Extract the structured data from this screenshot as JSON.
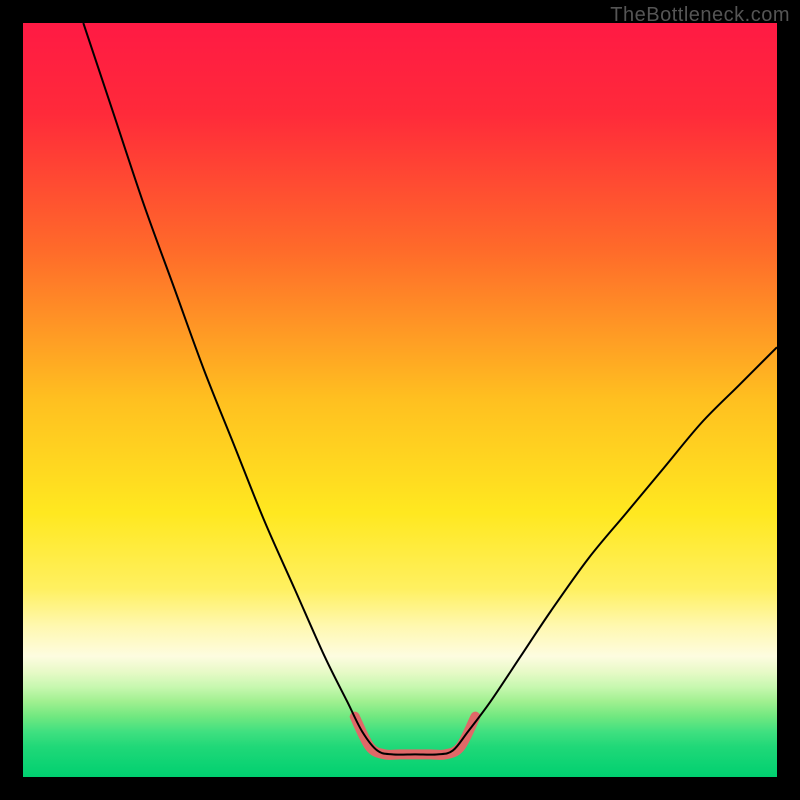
{
  "watermark": "TheBottleneck.com",
  "chart_data": {
    "type": "line",
    "title": "",
    "xlabel": "",
    "ylabel": "",
    "xlim": [
      0,
      100
    ],
    "ylim": [
      0,
      100
    ],
    "gradient_stops": [
      {
        "pos": 0,
        "color": "#ff1a44"
      },
      {
        "pos": 12,
        "color": "#ff2a3a"
      },
      {
        "pos": 30,
        "color": "#ff6a2a"
      },
      {
        "pos": 50,
        "color": "#ffc020"
      },
      {
        "pos": 65,
        "color": "#ffe820"
      },
      {
        "pos": 75,
        "color": "#fff060"
      },
      {
        "pos": 80,
        "color": "#fff8b0"
      },
      {
        "pos": 84,
        "color": "#fdfce0"
      },
      {
        "pos": 86,
        "color": "#e8fac8"
      },
      {
        "pos": 88,
        "color": "#c8f8b0"
      },
      {
        "pos": 90,
        "color": "#a0f090"
      },
      {
        "pos": 92,
        "color": "#70e880"
      },
      {
        "pos": 94,
        "color": "#40e080"
      },
      {
        "pos": 96,
        "color": "#20d878"
      },
      {
        "pos": 100,
        "color": "#00d070"
      }
    ],
    "series": [
      {
        "name": "bottleneck-curve",
        "stroke": "#000000",
        "stroke_width": 2,
        "points": [
          {
            "x": 8,
            "y": 100
          },
          {
            "x": 12,
            "y": 88
          },
          {
            "x": 16,
            "y": 76
          },
          {
            "x": 20,
            "y": 65
          },
          {
            "x": 24,
            "y": 54
          },
          {
            "x": 28,
            "y": 44
          },
          {
            "x": 32,
            "y": 34
          },
          {
            "x": 36,
            "y": 25
          },
          {
            "x": 40,
            "y": 16
          },
          {
            "x": 43,
            "y": 10
          },
          {
            "x": 45,
            "y": 6
          },
          {
            "x": 47,
            "y": 3.5
          },
          {
            "x": 49,
            "y": 3
          },
          {
            "x": 52,
            "y": 3
          },
          {
            "x": 55,
            "y": 3
          },
          {
            "x": 57,
            "y": 3.5
          },
          {
            "x": 59,
            "y": 6
          },
          {
            "x": 62,
            "y": 10
          },
          {
            "x": 66,
            "y": 16
          },
          {
            "x": 70,
            "y": 22
          },
          {
            "x": 75,
            "y": 29
          },
          {
            "x": 80,
            "y": 35
          },
          {
            "x": 85,
            "y": 41
          },
          {
            "x": 90,
            "y": 47
          },
          {
            "x": 95,
            "y": 52
          },
          {
            "x": 100,
            "y": 57
          }
        ]
      },
      {
        "name": "optimal-zone-highlight",
        "stroke": "#e06868",
        "stroke_width": 10,
        "points": [
          {
            "x": 44,
            "y": 8
          },
          {
            "x": 46,
            "y": 4
          },
          {
            "x": 48,
            "y": 3
          },
          {
            "x": 50,
            "y": 3
          },
          {
            "x": 52,
            "y": 3
          },
          {
            "x": 54,
            "y": 3
          },
          {
            "x": 56,
            "y": 3
          },
          {
            "x": 58,
            "y": 4
          },
          {
            "x": 60,
            "y": 8
          }
        ]
      }
    ]
  }
}
